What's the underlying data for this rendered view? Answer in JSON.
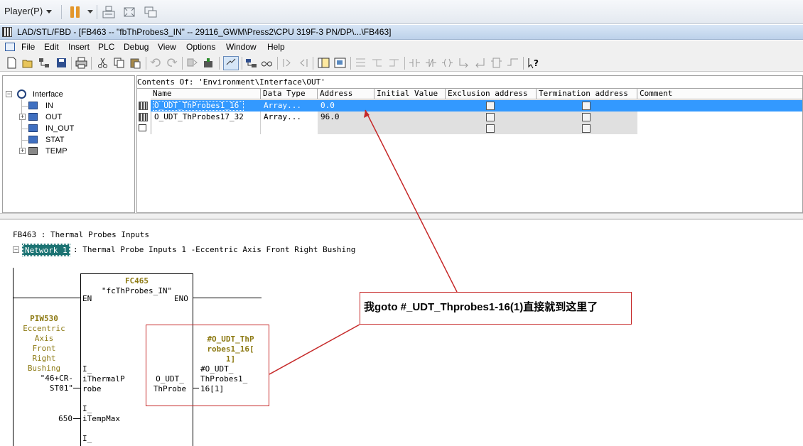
{
  "player": {
    "menu_label": "Player(P)"
  },
  "window": {
    "title": "LAD/STL/FBD  - [FB463 -- \"fbThProbes3_IN\" -- 29116_GWM\\Press2\\CPU 319F-3 PN/DP\\...\\FB463]"
  },
  "menu": {
    "items": [
      "File",
      "Edit",
      "Insert",
      "PLC",
      "Debug",
      "View",
      "Options",
      "Window",
      "Help"
    ]
  },
  "toolbar": {
    "icons": [
      "new-icon",
      "open-icon",
      "accessible-nodes-icon",
      "save-icon",
      "print-icon",
      "cut-icon",
      "copy-icon",
      "paste-icon",
      "undo-icon",
      "redo-icon",
      "download-icon",
      "monitor-icon",
      "run-icon",
      "network-icon",
      "glasses-icon",
      "insert-icon",
      "branch-icon",
      "overview-icon",
      "details-icon",
      "lad-contact-icon",
      "lad-coil-icon",
      "lad-box-icon",
      "help-icon"
    ]
  },
  "tree": {
    "root": "Interface",
    "items": [
      "IN",
      "OUT",
      "IN_OUT",
      "STAT",
      "TEMP"
    ]
  },
  "grid": {
    "contents_label": "Contents Of: 'Environment\\Interface\\OUT'",
    "columns": [
      "Name",
      "Data Type",
      "Address",
      "Initial Value",
      "Exclusion address",
      "Termination address",
      "Comment"
    ],
    "rows": [
      {
        "name": "O_UDT_ThProbes1_16",
        "data_type": "Array...",
        "address": "0.0"
      },
      {
        "name": "O_UDT_ThProbes17_32",
        "data_type": "Array...",
        "address": "96.0"
      }
    ]
  },
  "code": {
    "block_title": "FB463 : Thermal Probes Inputs",
    "network_label": "Network 1",
    "network_title": ": Thermal Probe Inputs 1 -Eccentric Axis Front Right Bushing",
    "box": {
      "name": "FC465",
      "symbol": "\"fcThProbes_IN\"",
      "en": "EN",
      "eno": "ENO",
      "in1": [
        "I_",
        "iThermalP",
        "robe"
      ],
      "in2": [
        "I_",
        "iTempMax"
      ],
      "in3": [
        "I_"
      ],
      "out1": [
        "O_UDT_",
        "ThProbe"
      ]
    },
    "input_operand": {
      "address": "PIW530",
      "symbol_lines": [
        "Eccentric",
        "Axis",
        "Front",
        "Right",
        "Bushing"
      ],
      "tag_lines": [
        "\"46+CR-",
        "ST01\""
      ]
    },
    "const_650": "650",
    "output_operand": {
      "symbol_lines": [
        "#O_UDT_ThP",
        "robes1_16[",
        "1]"
      ],
      "address_lines": [
        "#O_UDT_",
        "ThProbes1_",
        "16[1]"
      ]
    }
  },
  "callout": {
    "text": "我goto #_UDT_Thprobes1-16(1)直接就到这里了"
  },
  "colors": {
    "selection": "#3399ff",
    "annotation": "#c62828",
    "network_tag": "#1c7373",
    "operand_text": "#8d7a14"
  }
}
